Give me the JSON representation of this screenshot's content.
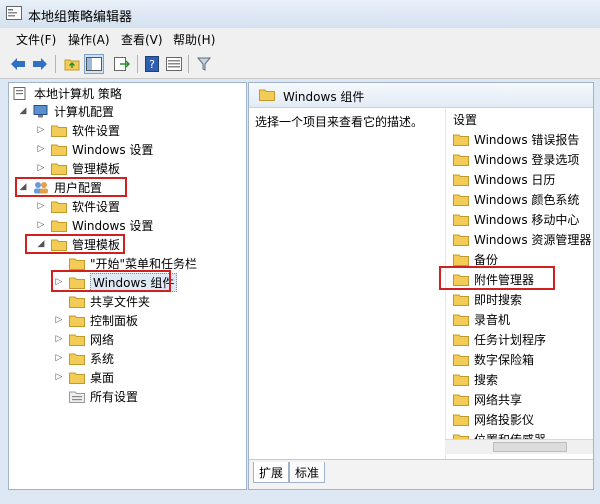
{
  "window": {
    "title": "本地组策略编辑器"
  },
  "menu": [
    "文件(F)",
    "操作(A)",
    "查看(V)",
    "帮助(H)"
  ],
  "tree": {
    "root": "本地计算机 策略",
    "computer_config": "计算机配置",
    "cc_software": "软件设置",
    "cc_windows": "Windows 设置",
    "cc_admin": "管理模板",
    "user_config": "用户配置",
    "uc_software": "软件设置",
    "uc_windows": "Windows 设置",
    "uc_admin": "管理模板",
    "start_menu": "\"开始\"菜单和任务栏",
    "windows_components": "Windows 组件",
    "shared_folders": "共享文件夹",
    "control_panel": "控制面板",
    "network": "网络",
    "system": "系统",
    "desktop": "桌面",
    "all_settings": "所有设置"
  },
  "right": {
    "header": "Windows 组件",
    "description": "选择一个项目来查看它的描述。",
    "column_header": "设置",
    "items": [
      "Windows 错误报告",
      "Windows 登录选项",
      "Windows 日历",
      "Windows 颜色系统",
      "Windows 移动中心",
      "Windows 资源管理器",
      "备份",
      "附件管理器",
      "即时搜索",
      "录音机",
      "任务计划程序",
      "数字保险箱",
      "搜索",
      "网络共享",
      "网络投影仪",
      "位置和传感器"
    ],
    "tabs": [
      "扩展",
      "标准"
    ]
  },
  "colors": {
    "highlight": "#d02020",
    "folder": "#f3cb57"
  }
}
